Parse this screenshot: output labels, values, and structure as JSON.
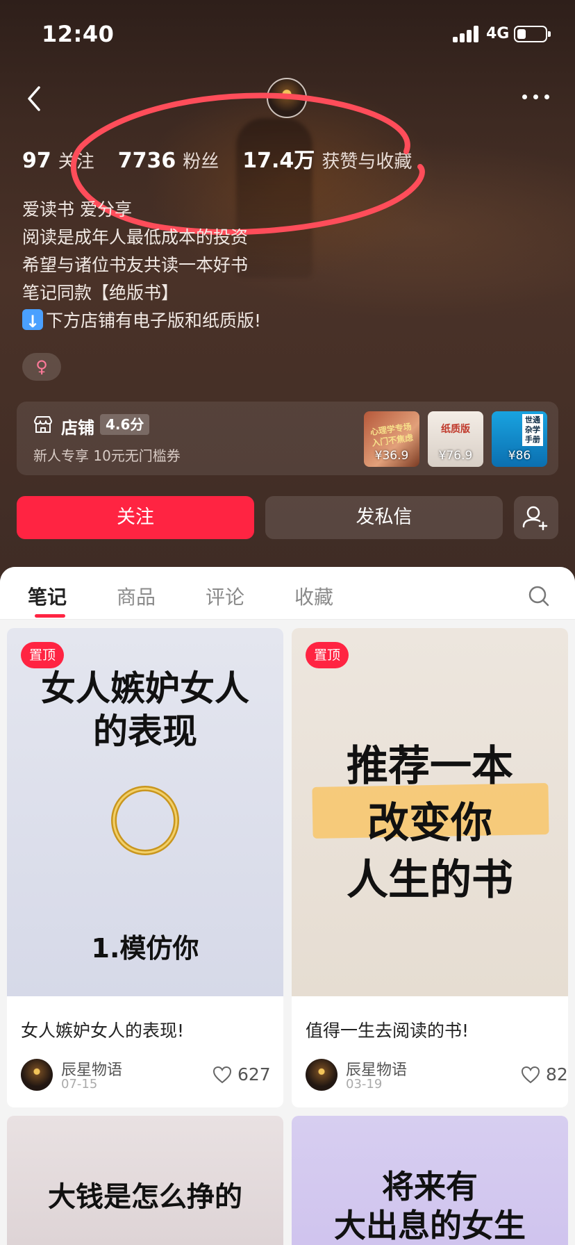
{
  "status_bar": {
    "time": "12:40",
    "network": "4G"
  },
  "stats": [
    {
      "value": "97",
      "label": "关注"
    },
    {
      "value": "7736",
      "label": "粉丝"
    },
    {
      "value": "17.4万",
      "label": "获赞与收藏"
    }
  ],
  "bio": [
    "爱读书 爱分享",
    "阅读是成年人最低成本的投资",
    "希望与诸位书友共读一本好书",
    "笔记同款【绝版书】",
    "下方店铺有电子版和纸质版!"
  ],
  "gender": "♀",
  "shop": {
    "title": "店铺",
    "score": "4.6分",
    "promo": "新人专享  10元无门槛券",
    "products": [
      {
        "price": "¥36.9",
        "text": "心理学专场入门不焦虑"
      },
      {
        "price": "¥76.9",
        "text": "纸质版"
      },
      {
        "price": "¥86",
        "text": "世通杂学手册"
      }
    ]
  },
  "actions": {
    "follow": "关注",
    "message": "发私信"
  },
  "tabs": [
    "笔记",
    "商品",
    "评论",
    "收藏"
  ],
  "notes": [
    {
      "pin": "置顶",
      "cover_title": "女人嫉妒女人的表现",
      "cover_subtitle": "1.模仿你",
      "title": "女人嫉妒女人的表现!",
      "author": "辰星物语",
      "date": "07-15",
      "likes": "627"
    },
    {
      "pin": "置顶",
      "cover_lines": [
        "推荐一本",
        "改变你",
        "人生的书"
      ],
      "title": "值得一生去阅读的书!",
      "author": "辰星物语",
      "date": "03-19",
      "likes": "82"
    },
    {
      "cover_title": "大钱是怎么挣的"
    },
    {
      "cover_lines": [
        "将来有",
        "大出息的女生"
      ]
    }
  ],
  "colors": {
    "accent": "#ff2442",
    "header_bg": "#3a2a24",
    "annotation": "#ff4d5a"
  }
}
